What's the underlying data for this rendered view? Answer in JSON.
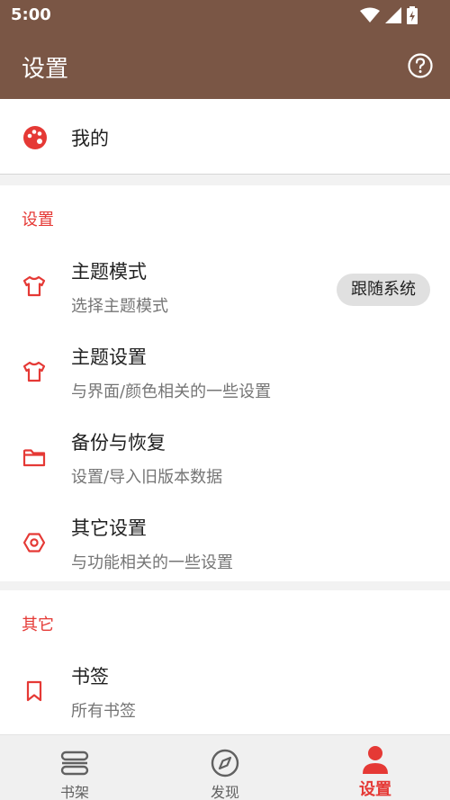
{
  "status_bar": {
    "time": "5:00"
  },
  "app_bar": {
    "title": "设置",
    "help_icon": "help-circle-icon"
  },
  "mine": {
    "label": "我的",
    "icon": "palette-icon"
  },
  "settings_section": {
    "title": "设置",
    "items": [
      {
        "title": "主题模式",
        "subtitle": "选择主题模式",
        "icon": "tshirt-icon",
        "value": "跟随系统"
      },
      {
        "title": "主题设置",
        "subtitle": "与界面/颜色相关的一些设置",
        "icon": "tshirt-icon"
      },
      {
        "title": "备份与恢复",
        "subtitle": "设置/导入旧版本数据",
        "icon": "folder-icon"
      },
      {
        "title": "其它设置",
        "subtitle": "与功能相关的一些设置",
        "icon": "hexagon-settings-icon"
      }
    ]
  },
  "others_section": {
    "title": "其它",
    "items": [
      {
        "title": "书签",
        "subtitle": "所有书签",
        "icon": "bookmark-icon"
      }
    ]
  },
  "bottom_nav": {
    "items": [
      {
        "label": "书架",
        "icon": "bookshelf-icon",
        "active": false
      },
      {
        "label": "发现",
        "icon": "compass-icon",
        "active": false
      },
      {
        "label": "设置",
        "icon": "person-icon",
        "active": true
      }
    ]
  },
  "colors": {
    "primary": "#7a5645",
    "accent": "#e53935",
    "background": "#f2f2f2"
  }
}
